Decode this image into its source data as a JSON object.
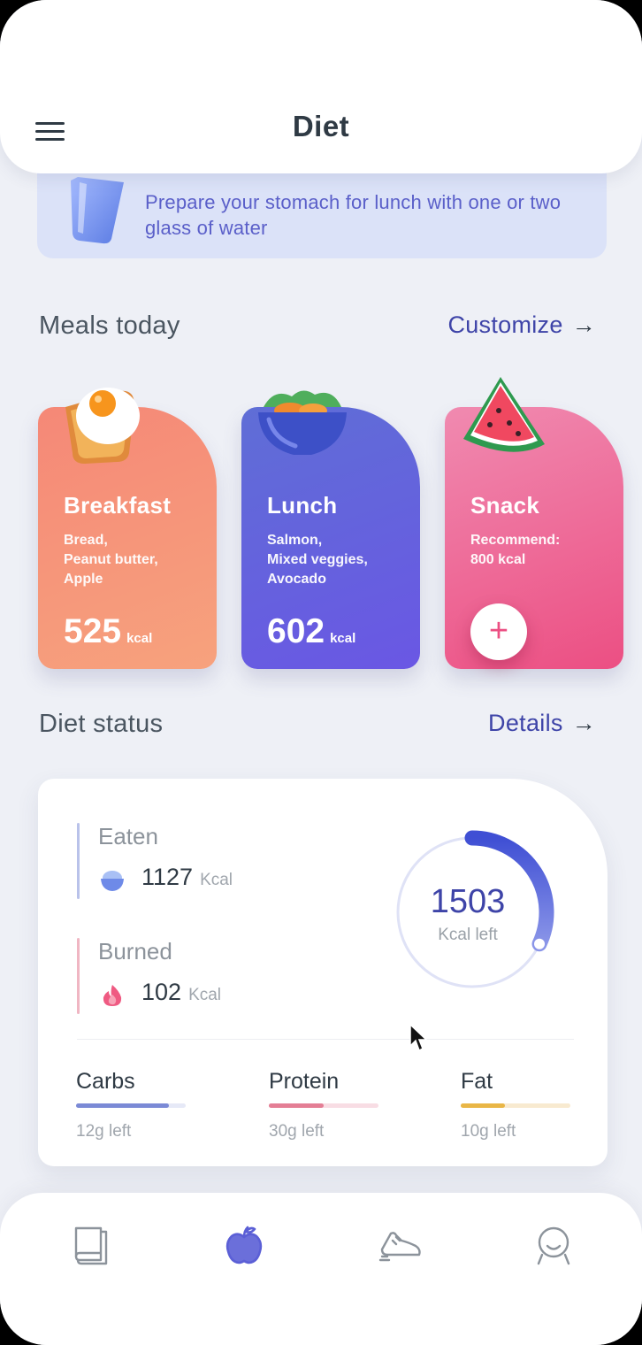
{
  "header": {
    "title": "Diet"
  },
  "tip": {
    "text": "Prepare your stomach for lunch with one or two glass of water"
  },
  "meals_section": {
    "title": "Meals today",
    "link": "Customize",
    "arrow": "→"
  },
  "meals": [
    {
      "name": "Breakfast",
      "desc_lines": [
        "Bread,",
        "Peanut butter,",
        "Apple"
      ],
      "kcal": "525",
      "unit": "kcal"
    },
    {
      "name": "Lunch",
      "desc_lines": [
        "Salmon,",
        "Mixed veggies,",
        "Avocado"
      ],
      "kcal": "602",
      "unit": "kcal"
    },
    {
      "name": "Snack",
      "desc_lines": [
        "Recommend:",
        "800 kcal"
      ],
      "add_label": "+"
    }
  ],
  "status_section": {
    "title": "Diet status",
    "link": "Details",
    "arrow": "→"
  },
  "status": {
    "eaten": {
      "label": "Eaten",
      "value": "1127",
      "unit": "Kcal"
    },
    "burned": {
      "label": "Burned",
      "value": "102",
      "unit": "Kcal"
    },
    "remaining": {
      "value": "1503",
      "label": "Kcal left",
      "progress": 0.32
    },
    "macros": [
      {
        "name": "Carbs",
        "left": "12g left",
        "progress": 0.85,
        "color": "#7b8ad6",
        "track": "#e6e9f7"
      },
      {
        "name": "Protein",
        "left": "30g left",
        "progress": 0.5,
        "color": "#e47e95",
        "track": "#f8dde4"
      },
      {
        "name": "Fat",
        "left": "10g left",
        "progress": 0.4,
        "color": "#e9b646",
        "track": "#f8ead0"
      }
    ]
  },
  "nav": {
    "items": [
      "book-icon",
      "apple-icon",
      "shoe-icon",
      "profile-icon"
    ],
    "active": 1,
    "active_color": "#5b5fd6",
    "inactive_color": "#8c939b"
  }
}
